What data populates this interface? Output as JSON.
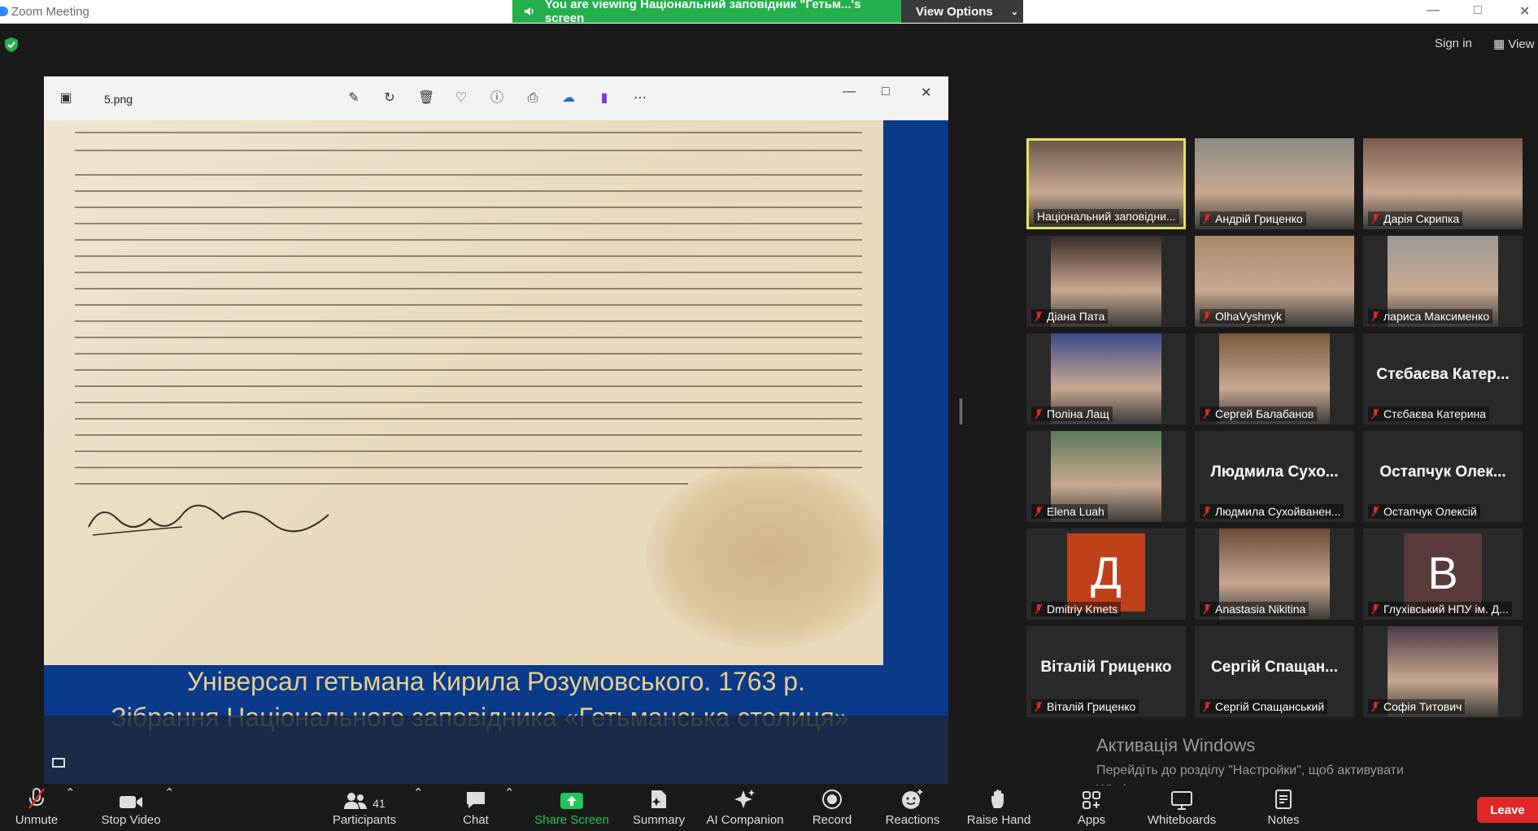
{
  "window": {
    "title": "Zoom Meeting",
    "share_banner": "You are viewing Національний заповідник \"Гетьм...'s screen",
    "view_options": "View Options",
    "signin": "Sign in",
    "view": "View"
  },
  "viewer": {
    "filename": "5.png"
  },
  "document": {
    "caption_line1": "Універсал гетьмана Кирила Розумовського. 1763 р.",
    "caption_line2": "Зібрання Національного заповідника «Гетьманська столиця»"
  },
  "participants": [
    {
      "name": "Національний заповідни...",
      "active": true
    },
    {
      "name": "Андрій Гриценко"
    },
    {
      "name": "Дарія Скрипка"
    },
    {
      "name": "Діана Пата"
    },
    {
      "name": "OlhaVyshnyk"
    },
    {
      "name": "лариса Максименко"
    },
    {
      "name": "Поліна Лащ"
    },
    {
      "name": "Сергей Балабанов"
    },
    {
      "name": "Стєбаєва Катерина",
      "big": "Стєбаєва Катер..."
    },
    {
      "name": "Elena Luah"
    },
    {
      "name": "Людмила Сухойванен...",
      "big": "Людмила Сухо..."
    },
    {
      "name": "Остапчук Олексій",
      "big": "Остапчук Олек..."
    },
    {
      "name": "Dmitriy Kmets",
      "avatar": "Д"
    },
    {
      "name": "Anastasia Nikitina"
    },
    {
      "name": "Глухівський НПУ ім. Д...",
      "avatar": "В"
    },
    {
      "name": "Віталій Гриценко",
      "big": "Віталій Гриценко"
    },
    {
      "name": "Сергій Спащанський",
      "big": "Сергій Спащан..."
    },
    {
      "name": "Софія Титович"
    }
  ],
  "activation": {
    "line1": "Активація Windows",
    "line2": "Перейдіть до розділу \"Настройки\", щоб активувати Windows."
  },
  "toolbar": {
    "unmute": "Unmute",
    "stop_video": "Stop Video",
    "participants": "Participants",
    "participants_count": "41",
    "chat": "Chat",
    "share_screen": "Share Screen",
    "summary": "Summary",
    "ai_companion": "AI Companion",
    "record": "Record",
    "reactions": "Reactions",
    "raise_hand": "Raise Hand",
    "apps": "Apps",
    "whiteboards": "Whiteboards",
    "notes": "Notes",
    "leave": "Leave"
  }
}
